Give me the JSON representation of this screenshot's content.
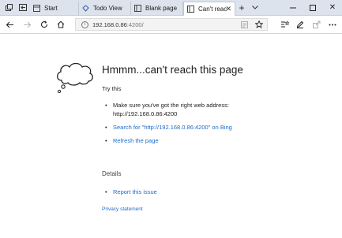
{
  "tabs": [
    {
      "label": "Start",
      "icon": "start-page-icon"
    },
    {
      "label": "Todo View",
      "icon": "app-icon"
    },
    {
      "label": "Blank page",
      "icon": "page-icon"
    },
    {
      "label": "Can't reac",
      "icon": "page-icon",
      "active": true
    }
  ],
  "address": {
    "host": "192.168.0.86",
    "path": ":4200/"
  },
  "error": {
    "title": "Hmmm...can't reach this page",
    "try_this": "Try this",
    "suggestion_check": "Make sure you've got the right web address: http://192.168.0.86:4200",
    "suggestion_search": "Search for \"http://192.168.0.86:4200\" on Bing",
    "suggestion_refresh": "Refresh the page",
    "details_heading": "Details",
    "report_issue": "Report this issue",
    "privacy": "Privacy statement"
  },
  "colors": {
    "link": "#1e6cc8",
    "tab_strip": "#dde3ec"
  }
}
